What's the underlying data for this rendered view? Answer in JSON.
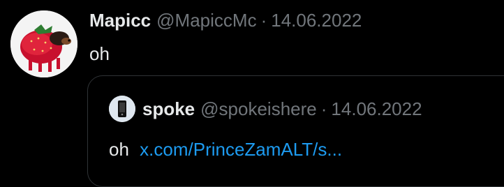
{
  "tweet": {
    "author_name": "Mapicc",
    "author_handle": "@MapiccMc",
    "separator": "·",
    "date": "14.06.2022",
    "text": "oh",
    "avatar_icon": "strawberry-dog-avatar-icon"
  },
  "quote": {
    "author_name": "spoke",
    "author_handle": "@spokeishere",
    "separator": "·",
    "date": "14.06.2022",
    "text": "oh",
    "link_text": "x.com/PrinceZamALT/s...",
    "avatar_icon": "phone-avatar-icon"
  },
  "colors": {
    "background": "#000000",
    "primary_text": "#e7e9ea",
    "secondary_text": "#71767b",
    "link": "#1d9bf0",
    "border": "#2f3336"
  }
}
